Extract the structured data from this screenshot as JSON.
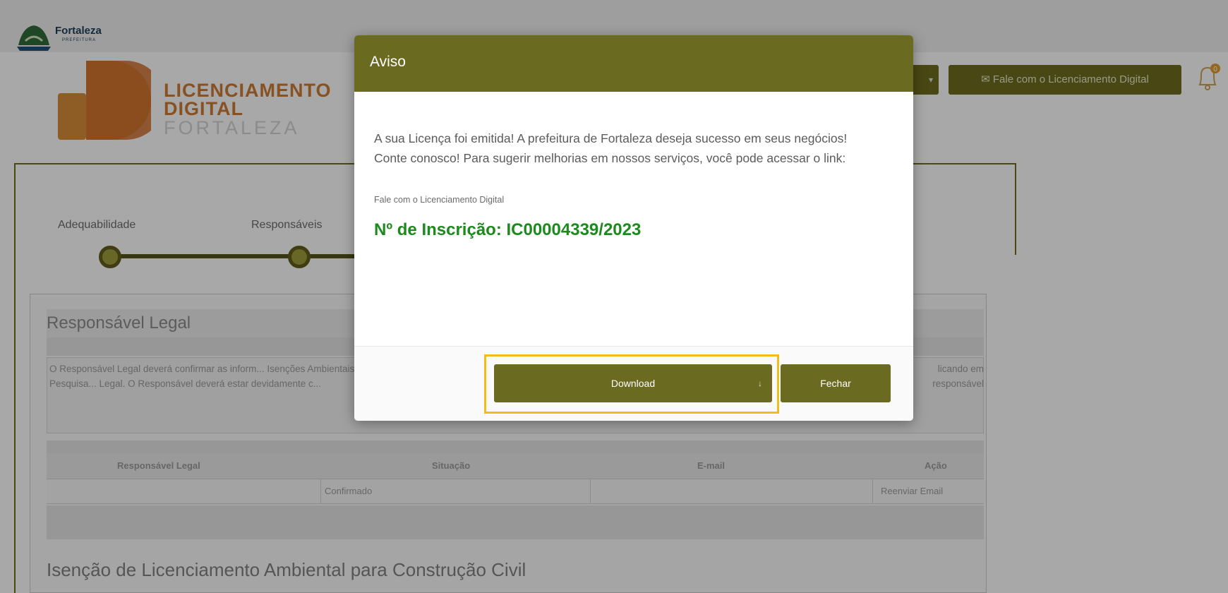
{
  "brand": {
    "name": "Fortaleza",
    "sub": "PREFEITURA"
  },
  "licenciamento": {
    "line1": "LICENCIAMENTO",
    "line2": "DIGITAL",
    "line3": "FORTALEZA"
  },
  "header": {
    "contact_button": "✉ Fale com o Licenciamento Digital",
    "dropdown_caret": "▾",
    "notifications_count": "0"
  },
  "steps": [
    "Adequabilidade",
    "Responsáveis"
  ],
  "panel": {
    "title": "Responsável Legal",
    "info_left": "O Responsável Legal deverá confirmar as inform... Isenções Ambientais para Construção > Pesquisa... Legal. O Responsável deverá estar devidamente c...",
    "info_right": "licando em responsável",
    "table": {
      "headers": [
        "Responsável Legal",
        "Situação",
        "E-mail",
        "Ação"
      ],
      "row": [
        "",
        "Confirmado",
        "",
        "Reenviar Email"
      ]
    },
    "section2_title": "Isenção de Licenciamento Ambiental para Construção Civil"
  },
  "modal": {
    "title": "Aviso",
    "message": "A sua Licença foi emitida! A prefeitura de Fortaleza deseja sucesso em seus negócios! Conte conosco! Para sugerir melhorias em nossos serviços, você pode acessar o link:",
    "link": "Fale com o Licenciamento Digital",
    "inscricao": "Nº de Inscrição: IC00004339/2023",
    "download_label": "Download",
    "download_icon": "↓",
    "close_label": "Fechar"
  },
  "colors": {
    "olive": "#6b6a21",
    "highlight": "#f2bd1c",
    "inscricao_green": "#1c8a1c"
  }
}
